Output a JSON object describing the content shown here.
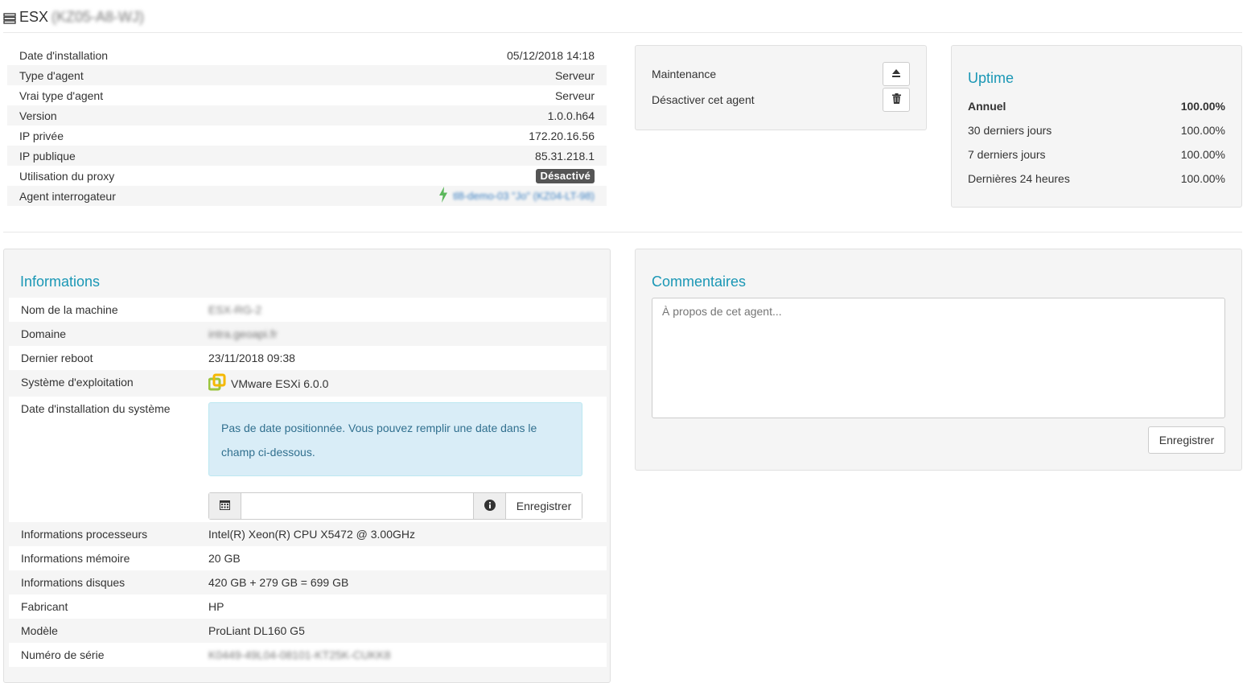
{
  "header": {
    "title": "ESX",
    "hostname_blurred": "(KZ05-A8-WJ)"
  },
  "summary": [
    {
      "label": "Date d'installation",
      "value": "05/12/2018 14:18"
    },
    {
      "label": "Type d'agent",
      "value": "Serveur"
    },
    {
      "label": "Vrai type d'agent",
      "value": "Serveur"
    },
    {
      "label": "Version",
      "value": "1.0.0.h64"
    },
    {
      "label": "IP privée",
      "value": "172.20.16.56"
    },
    {
      "label": "IP publique",
      "value": "85.31.218.1"
    },
    {
      "label": "Utilisation du proxy",
      "value": "Désactivé"
    },
    {
      "label": "Agent interrogateur",
      "value": "tl8-demo-03 \"Jo\" (KZ04-LT-98)"
    }
  ],
  "actions": {
    "maintenance_label": "Maintenance",
    "disable_label": "Désactiver cet agent"
  },
  "uptime": {
    "title": "Uptime",
    "rows": [
      {
        "label": "Annuel",
        "value": "100.00%"
      },
      {
        "label": "30 derniers jours",
        "value": "100.00%"
      },
      {
        "label": "7 derniers jours",
        "value": "100.00%"
      },
      {
        "label": "Dernières 24 heures",
        "value": "100.00%"
      }
    ]
  },
  "informations": {
    "title": "Informations",
    "machine_label": "Nom de la machine",
    "machine_value": "ESX-RG-2",
    "domain_label": "Domaine",
    "domain_value": "intra.geoapi.fr",
    "reboot_label": "Dernier reboot",
    "reboot_value": "23/11/2018 09:38",
    "os_label": "Système d'exploitation",
    "os_value": "VMware ESXi 6.0.0",
    "install_label": "Date d'installation du système",
    "install_alert": "Pas de date positionnée. Vous pouvez remplir une date dans le champ ci-dessous.",
    "save_label": "Enregistrer",
    "cpu_label": "Informations processeurs",
    "cpu_value": "Intel(R) Xeon(R) CPU X5472 @ 3.00GHz",
    "mem_label": "Informations mémoire",
    "mem_value": "20 GB",
    "disk_label": "Informations disques",
    "disk_value": "420 GB + 279 GB = 699 GB",
    "maker_label": "Fabricant",
    "maker_value": "HP",
    "model_label": "Modèle",
    "model_value": "ProLiant DL160 G5",
    "serial_label": "Numéro de série",
    "serial_value": "K0449-49L04-08101-KT25K-CUKK8"
  },
  "comments": {
    "title": "Commentaires",
    "placeholder": "À propos de cet agent...",
    "save_label": "Enregistrer"
  },
  "colors": {
    "accent": "#1a97b5",
    "badge": "#555555",
    "alert_bg": "#d9edf7",
    "alert_text": "#31708f",
    "bolt": "#5cb85c"
  }
}
